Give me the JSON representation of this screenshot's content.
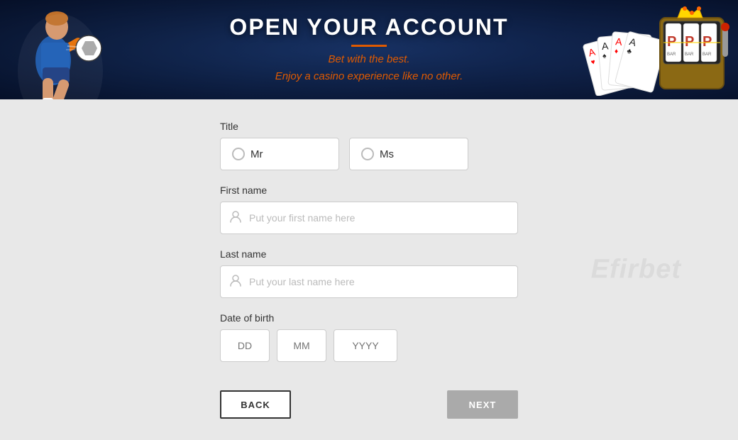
{
  "header": {
    "title": "OPEN YOUR ACCOUNT",
    "subtitle_line1": "Bet with the best.",
    "subtitle_line2": "Enjoy a casino experience like no other."
  },
  "form": {
    "title_label": "Title",
    "title_options": [
      {
        "value": "mr",
        "label": "Mr"
      },
      {
        "value": "ms",
        "label": "Ms"
      }
    ],
    "first_name_label": "First name",
    "first_name_placeholder": "Put your first name here",
    "last_name_label": "Last name",
    "last_name_placeholder": "Put your last name here",
    "dob_label": "Date of birth",
    "dob_dd_placeholder": "DD",
    "dob_mm_placeholder": "MM",
    "dob_yyyy_placeholder": "YYYY"
  },
  "buttons": {
    "back_label": "BACK",
    "next_label": "NEXT"
  },
  "watermark": {
    "text": "Efirbet"
  }
}
